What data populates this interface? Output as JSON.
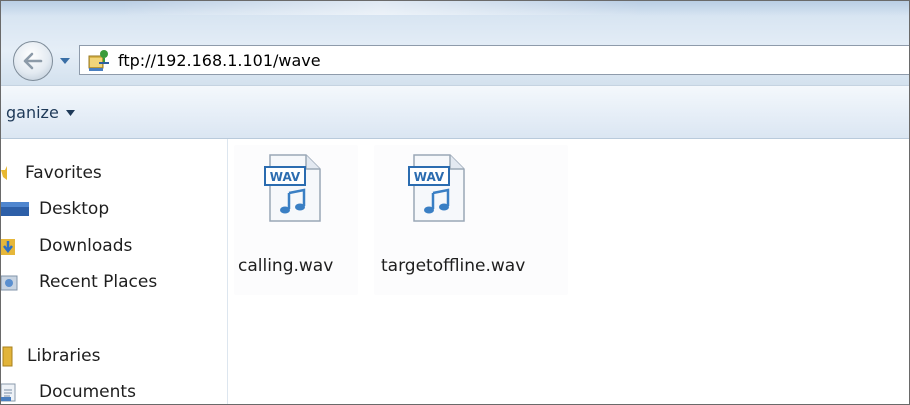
{
  "address": {
    "path": "ftp://192.168.1.101/wave"
  },
  "toolbar": {
    "organize_label": "ganize"
  },
  "nav": {
    "items": [
      {
        "label": "Favorites",
        "icon": "star-icon",
        "indent": false
      },
      {
        "label": "Desktop",
        "icon": "desktop-icon",
        "indent": true
      },
      {
        "label": "Downloads",
        "icon": "downloads-icon",
        "indent": true
      },
      {
        "label": "Recent Places",
        "icon": "recent-places-icon",
        "indent": true
      },
      {
        "label": "Libraries",
        "icon": "libraries-icon",
        "indent": false
      },
      {
        "label": "Documents",
        "icon": "documents-icon",
        "indent": true
      }
    ]
  },
  "files": [
    {
      "name": "calling.wav",
      "badge": "WAV",
      "icon": "wav-file-icon"
    },
    {
      "name": "targetoffline.wav",
      "badge": "WAV",
      "icon": "wav-file-icon"
    }
  ],
  "colors": {
    "accent": "#1e3958",
    "wav_badge": "#2b6cb0",
    "wav_note": "#3a7fc4"
  }
}
